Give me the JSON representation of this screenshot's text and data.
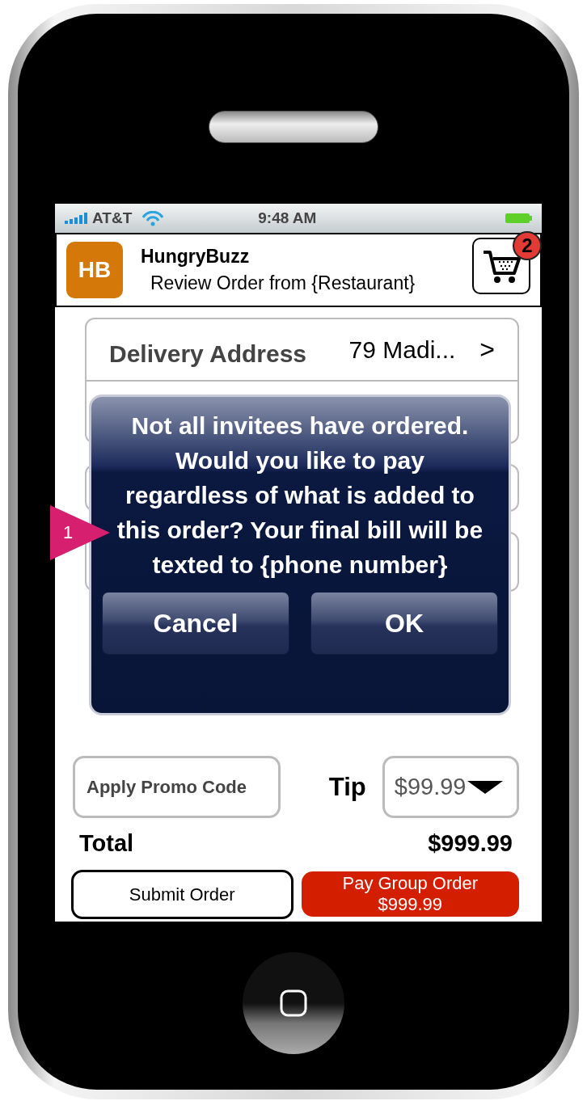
{
  "status_bar": {
    "carrier": "AT&T",
    "time": "9:48 AM"
  },
  "header": {
    "logo": "HB",
    "title": "HungryBuzz",
    "subtitle": "Review Order from {Restaurant}",
    "cart_count": "2"
  },
  "delivery": {
    "label": "Delivery Address",
    "value": "79 Madi...",
    "chevron": ">"
  },
  "promo_button": "Apply Promo Code",
  "tip": {
    "label": "Tip",
    "value": "$99.99"
  },
  "total": {
    "label": "Total",
    "amount": "$999.99"
  },
  "buttons": [
    {
      "kind": "outline",
      "lines": [
        "Submit Order"
      ]
    },
    {
      "kind": "primary",
      "lines": [
        "Pay Group Order",
        "$999.99"
      ]
    }
  ],
  "alert": {
    "message": "Not all invitees have ordered. Would you like to pay regardless of what is added to this order? Your final bill will be texted to {phone number}",
    "buttons": [
      "Cancel",
      "OK"
    ]
  },
  "callout": {
    "number": "1"
  }
}
